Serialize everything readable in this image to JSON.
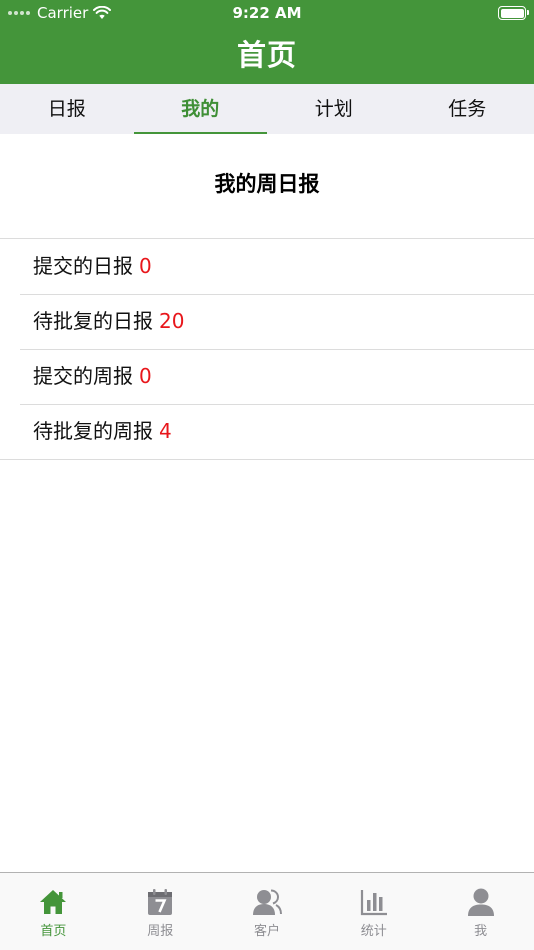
{
  "status_bar": {
    "carrier": "Carrier",
    "time": "9:22 AM"
  },
  "nav": {
    "title": "首页"
  },
  "tabs": [
    {
      "label": "日报"
    },
    {
      "label": "我的",
      "active": true
    },
    {
      "label": "计划"
    },
    {
      "label": "任务"
    }
  ],
  "section": {
    "title": "我的周日报"
  },
  "rows": [
    {
      "label": "提交的日报",
      "count": "0"
    },
    {
      "label": "待批复的日报",
      "count": "20"
    },
    {
      "label": "提交的周报",
      "count": "0"
    },
    {
      "label": "待批复的周报",
      "count": "4"
    }
  ],
  "tabbar": [
    {
      "label": "首页",
      "icon": "home-icon",
      "active": true
    },
    {
      "label": "周报",
      "icon": "calendar-icon"
    },
    {
      "label": "客户",
      "icon": "customers-icon"
    },
    {
      "label": "统计",
      "icon": "bar-chart-icon"
    },
    {
      "label": "我",
      "icon": "person-icon"
    }
  ],
  "colors": {
    "accent": "#44953a",
    "count": "#e8161b",
    "tab_bg": "#efeff4"
  }
}
